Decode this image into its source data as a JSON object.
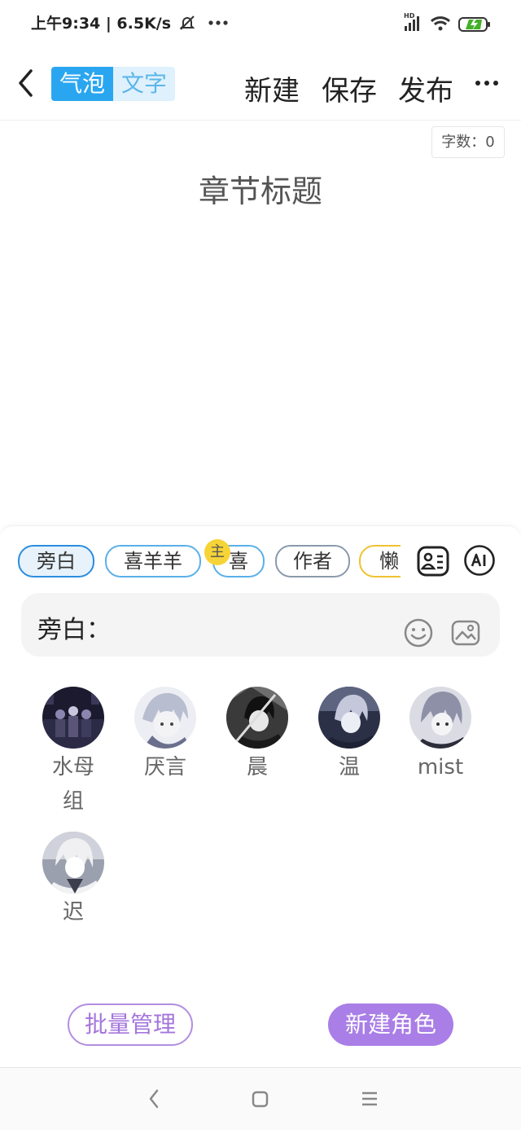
{
  "status_bar": {
    "time_speed": "上午9:34 | 6.5K/s",
    "net_type": "HD",
    "icons": [
      "mute-icon",
      "more-dots-icon",
      "signal-icon",
      "wifi-icon",
      "battery-charging-icon"
    ]
  },
  "toolbar": {
    "mode_bubble": "气泡",
    "mode_text": "文字",
    "new_label": "新建",
    "save_label": "保存",
    "publish_label": "发布"
  },
  "editor": {
    "word_count": "字数：0",
    "chapter_title_placeholder": "章节标题"
  },
  "speaker_chips": [
    {
      "label": "旁白",
      "selected": true
    },
    {
      "label": "喜羊羊",
      "selected": false
    },
    {
      "label": "喜",
      "selected": false,
      "badge": "主"
    },
    {
      "label": "作者",
      "selected": false
    },
    {
      "label": "懒",
      "selected": false
    }
  ],
  "input": {
    "speaker_label": "旁白："
  },
  "roles": [
    {
      "name": "水母组"
    },
    {
      "name": "厌言"
    },
    {
      "name": "晨"
    },
    {
      "name": "温"
    },
    {
      "name": "mist"
    },
    {
      "name": "迟"
    }
  ],
  "actions": {
    "batch_manage": "批量管理",
    "new_role": "新建角色"
  },
  "colors": {
    "accent_blue": "#2aa6f0",
    "accent_purple": "#a97ee6",
    "badge_yellow": "#f6d437"
  }
}
